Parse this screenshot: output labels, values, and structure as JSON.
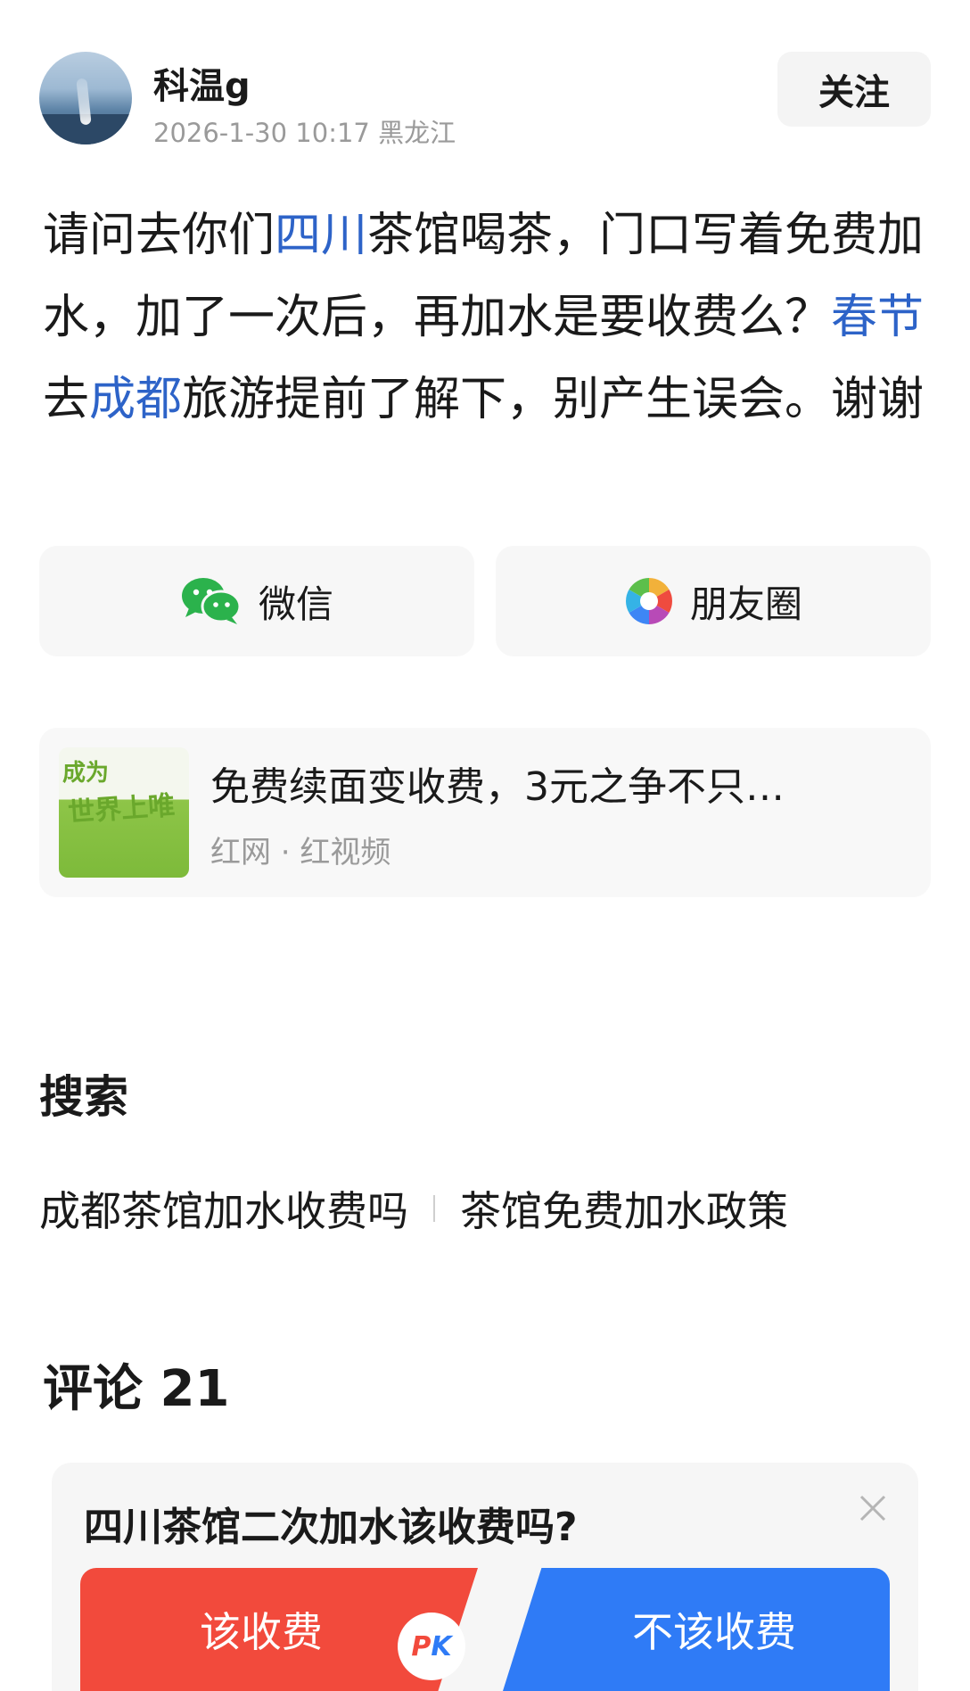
{
  "header": {
    "username": "科温g",
    "meta": "2026-1-30 10:17 黑龙江",
    "follow_label": "关注"
  },
  "post": {
    "segments": [
      {
        "text": "请问去你们",
        "highlight": false
      },
      {
        "text": "四川",
        "highlight": true
      },
      {
        "text": "茶馆喝茶，门口写着免费加水，加了一次后，再加水是要收费么？",
        "highlight": false
      },
      {
        "text": "春节",
        "highlight": true
      },
      {
        "text": "去",
        "highlight": false
      },
      {
        "text": "成都",
        "highlight": true
      },
      {
        "text": "旅游提前了解下，别产生误会。谢谢",
        "highlight": false
      }
    ],
    "highlight_color": "#2d63c8"
  },
  "share": {
    "wechat_label": "微信",
    "moments_label": "朋友圈"
  },
  "article": {
    "thumb_text_1": "成为",
    "thumb_text_2": "世界上唯",
    "title": "免费续面变收费，3元之争不只…",
    "source": "红网 · 红视频"
  },
  "search": {
    "heading": "搜索",
    "suggestions": [
      "成都茶馆加水收费吗",
      "茶馆免费加水政策"
    ]
  },
  "comments": {
    "heading": "评论 21"
  },
  "poll": {
    "question": "四川茶馆二次加水该收费吗?",
    "left_option": "该收费",
    "right_option": "不该收费",
    "pk_p": "P",
    "pk_k": "K",
    "left_color": "#f24a3c",
    "right_color": "#2f7bf6"
  }
}
